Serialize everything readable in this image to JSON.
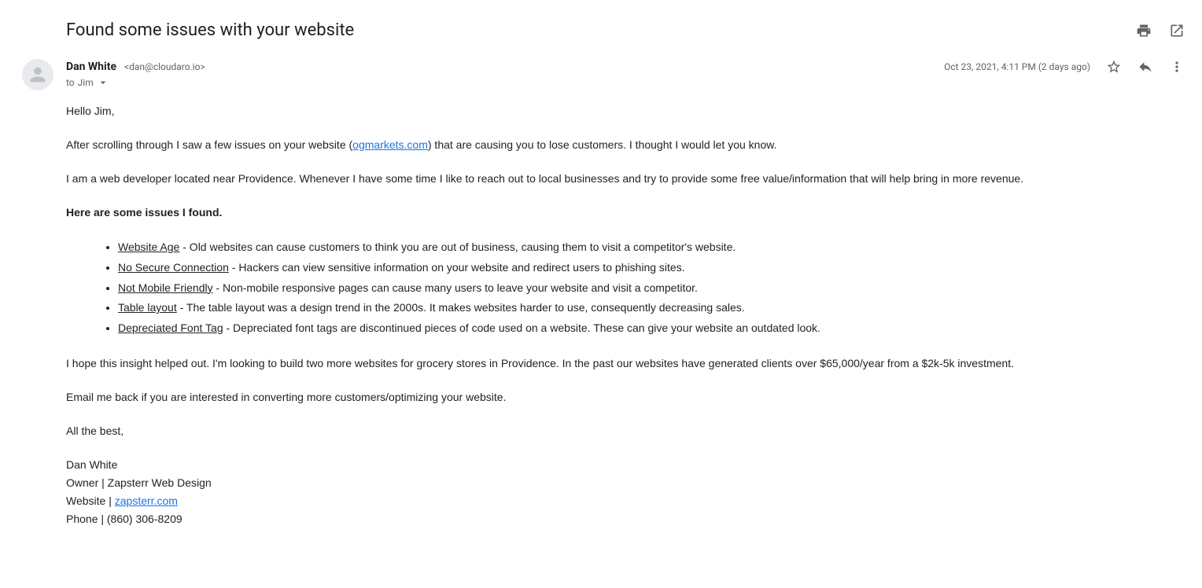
{
  "subject": "Found some issues with your website",
  "sender": {
    "name": "Dan White",
    "email": "<dan@cloudaro.io>",
    "to_prefix": "to",
    "to_name": "Jim"
  },
  "meta": {
    "date": "Oct 23, 2021, 4:11 PM (2 days ago)"
  },
  "body": {
    "greeting": "Hello Jim,",
    "p1_a": "After scrolling through I saw a few issues on your website (",
    "p1_link": "ogmarkets.com",
    "p1_b": ") that are causing you to lose customers. I thought I would let you know.",
    "p2": "I am a web developer located near Providence. Whenever I have some time I like to reach out to local businesses and try to provide some free value/information that will help bring in more revenue.",
    "issues_heading": "Here are some issues I found.",
    "issues": [
      {
        "term": "Website Age",
        "desc": " - Old websites can cause customers to think you are out of business, causing them to visit a competitor's website."
      },
      {
        "term": "No Secure Connection",
        "desc": " - Hackers can view sensitive information on your website and redirect users to phishing sites."
      },
      {
        "term": "Not Mobile Friendly",
        "desc": " - Non-mobile responsive pages can cause many users to leave your website and visit a competitor."
      },
      {
        "term": "Table layout",
        "desc": " - The table layout was a design trend in the 2000s. It makes websites harder to use, consequently decreasing sales."
      },
      {
        "term": "Depreciated Font Tag",
        "desc": " - Depreciated font tags are discontinued pieces of code used on a website. These can give your website an outdated look."
      }
    ],
    "p3": "I hope this insight helped out. I'm looking to build two more websites for grocery stores in Providence. In the past our websites have generated clients over $65,000/year from a $2k-5k investment.",
    "p4": "Email me back if you are interested in converting more customers/optimizing your website.",
    "closing": "All the best,",
    "sig_name": "Dan White",
    "sig_title": "Owner | Zapsterr Web Design",
    "sig_site_prefix": "Website | ",
    "sig_site_link": "zapsterr.com",
    "sig_phone": "Phone | (860) 306-8209"
  }
}
